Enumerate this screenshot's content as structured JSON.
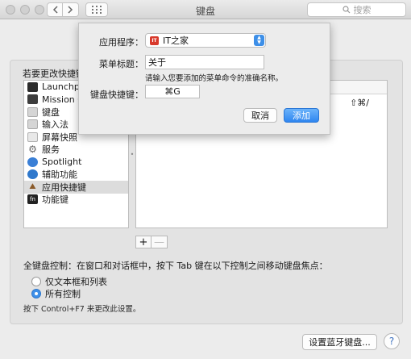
{
  "window": {
    "title": "键盘"
  },
  "search": {
    "placeholder": "搜索",
    "icon": "search-icon"
  },
  "section": {
    "label": "若要更改快捷键"
  },
  "sidebar": {
    "items": [
      {
        "label": "Launchpa",
        "icon": "launchpad-icon"
      },
      {
        "label": "Mission C",
        "icon": "mission-control-icon"
      },
      {
        "label": "键盘",
        "icon": "keyboard-icon"
      },
      {
        "label": "输入法",
        "icon": "input-method-icon"
      },
      {
        "label": "屏幕快照",
        "icon": "screenshot-icon"
      },
      {
        "label": "服务",
        "icon": "gear-icon"
      },
      {
        "label": "Spotlight",
        "icon": "spotlight-icon"
      },
      {
        "label": "辅助功能",
        "icon": "accessibility-icon"
      },
      {
        "label": "应用快捷键",
        "icon": "app-shortcuts-icon",
        "selected": true
      },
      {
        "label": "功能键",
        "icon": "fn-key-icon",
        "badge": "fn"
      }
    ]
  },
  "table": {
    "shortcut": "⇧⌘/"
  },
  "buttons": {
    "add": "+",
    "remove": "—"
  },
  "keyboard_control": {
    "label": "全键盘控制：在窗口和对话框中，按下 Tab 键在以下控制之间移动键盘焦点：",
    "options": [
      {
        "label": "仅文本框和列表",
        "selected": false
      },
      {
        "label": "所有控制",
        "selected": true
      }
    ],
    "hint": "按下 Control+F7 来更改此设置。"
  },
  "footer": {
    "bluetooth_label": "设置蓝牙键盘...",
    "help_label": "?"
  },
  "dialog": {
    "app_label": "应用程序：",
    "app_value": "IT之家",
    "app_icon_text": "IT",
    "menu_title_label": "菜单标题：",
    "menu_title_value": "关于",
    "menu_title_hint": "请输入您要添加的菜单命令的准确名称。",
    "shortcut_label": "键盘快捷键：",
    "shortcut_value": "⌘G",
    "cancel_label": "取消",
    "add_label": "添加"
  },
  "colors": {
    "accent": "#3d8fe8",
    "app_icon": "#d8392b"
  }
}
